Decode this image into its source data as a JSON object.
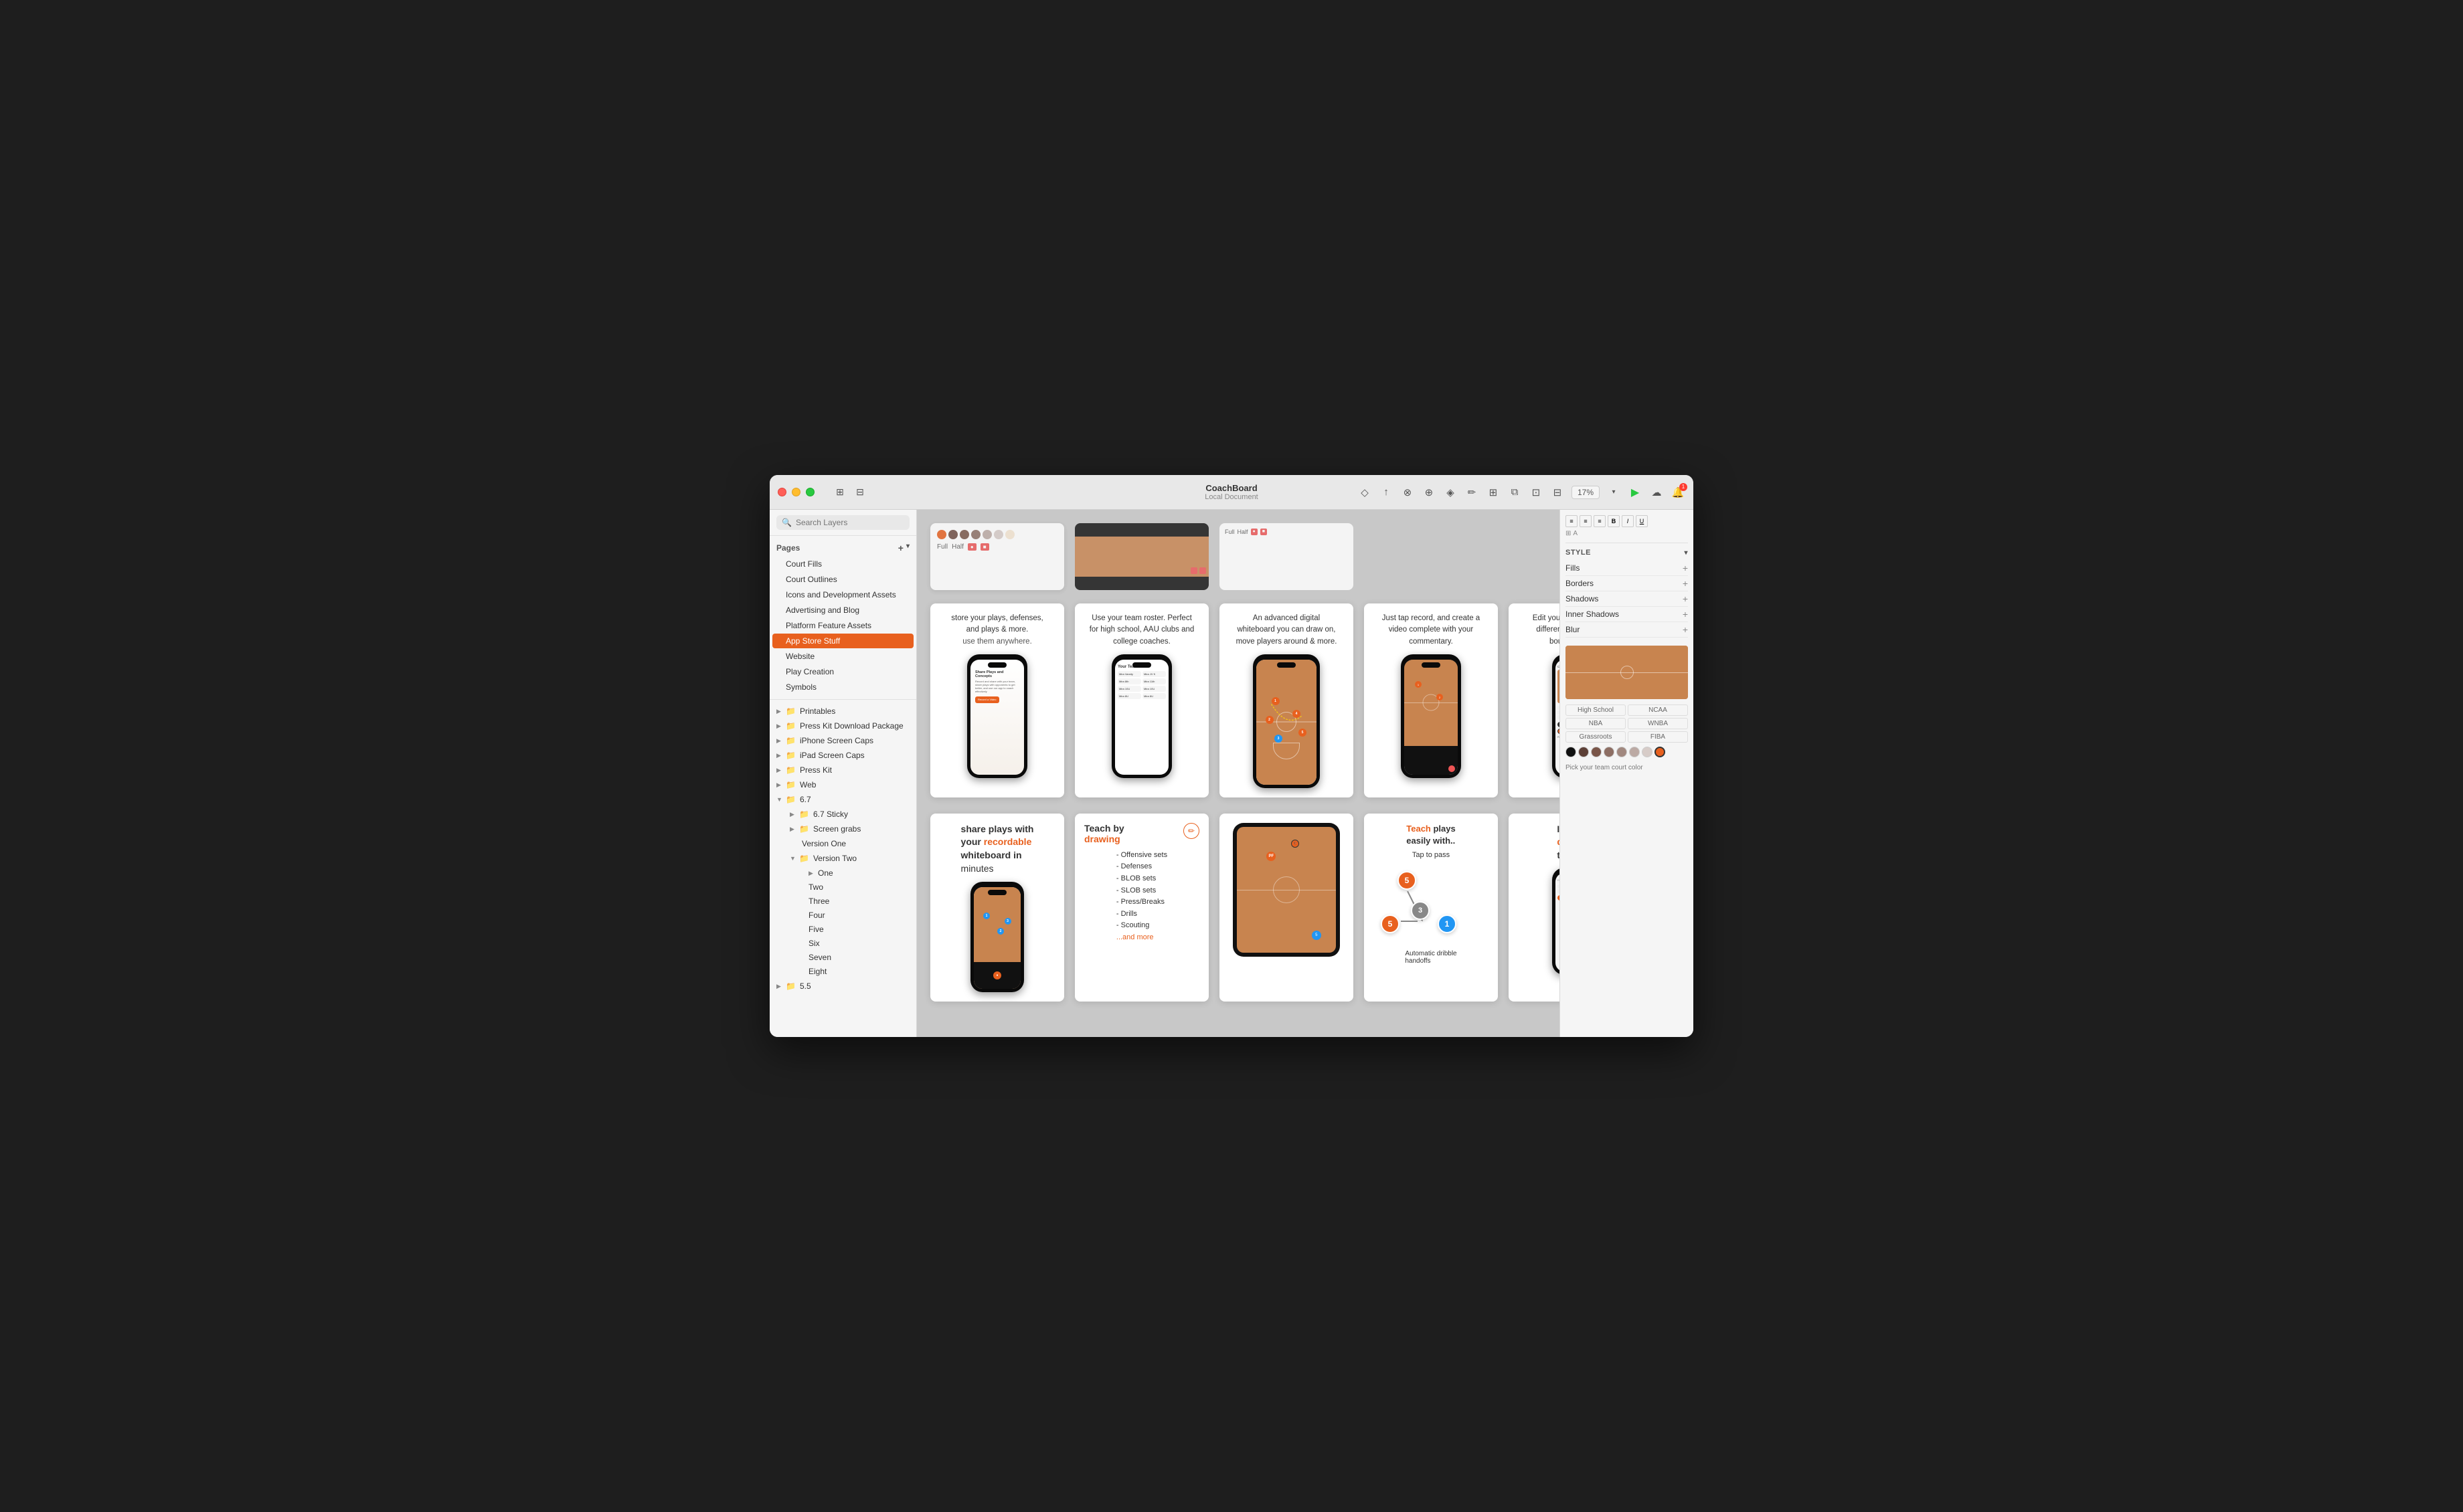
{
  "window": {
    "title": "CoachBoard",
    "subtitle": "Local Document"
  },
  "trafficLights": {
    "red": "close",
    "yellow": "minimize",
    "green": "maximize"
  },
  "toolbar": {
    "addButton": "+",
    "zoomLevel": "17%"
  },
  "sidebar": {
    "searchPlaceholder": "Search Layers",
    "sections": {
      "pages": {
        "label": "Pages",
        "items": [
          {
            "id": "court-fills",
            "label": "Court Fills",
            "active": false
          },
          {
            "id": "court-outlines",
            "label": "Court Outlines",
            "active": false
          },
          {
            "id": "icons-dev",
            "label": "Icons and Development Assets",
            "active": false
          },
          {
            "id": "advertising",
            "label": "Advertising and Blog",
            "active": false
          },
          {
            "id": "platform",
            "label": "Platform Feature Assets",
            "active": false
          },
          {
            "id": "app-store",
            "label": "App Store Stuff",
            "active": true
          },
          {
            "id": "website",
            "label": "Website",
            "active": false
          },
          {
            "id": "play-creation",
            "label": "Play Creation",
            "active": false
          },
          {
            "id": "symbols",
            "label": "Symbols",
            "active": false
          }
        ]
      }
    },
    "layers": {
      "items": [
        {
          "id": "printables",
          "label": "Printables",
          "expanded": false,
          "type": "group"
        },
        {
          "id": "press-kit",
          "label": "Press Kit Download Package",
          "expanded": false,
          "type": "group"
        },
        {
          "id": "iphone-caps",
          "label": "iPhone Screen Caps",
          "expanded": false,
          "type": "group"
        },
        {
          "id": "ipad-caps",
          "label": "iPad Screen Caps",
          "expanded": false,
          "type": "group"
        },
        {
          "id": "press-kit2",
          "label": "Press Kit",
          "expanded": false,
          "type": "group"
        },
        {
          "id": "web",
          "label": "Web",
          "expanded": false,
          "type": "group"
        },
        {
          "id": "v67",
          "label": "6.7",
          "expanded": true,
          "type": "group",
          "children": [
            {
              "id": "67sticky",
              "label": "6.7 Sticky",
              "type": "group",
              "expanded": false
            },
            {
              "id": "screengrabs",
              "label": "Screen grabs",
              "type": "group",
              "expanded": false
            },
            {
              "id": "versionone",
              "label": "Version One",
              "type": "item"
            },
            {
              "id": "versiontwo",
              "label": "Version Two",
              "type": "group",
              "expanded": true,
              "children": [
                {
                  "id": "one",
                  "label": "One",
                  "type": "item"
                },
                {
                  "id": "two",
                  "label": "Two",
                  "type": "item"
                },
                {
                  "id": "three",
                  "label": "Three",
                  "type": "item"
                },
                {
                  "id": "four",
                  "label": "Four",
                  "type": "item"
                },
                {
                  "id": "five",
                  "label": "Five",
                  "type": "item"
                },
                {
                  "id": "six",
                  "label": "Six",
                  "type": "item"
                },
                {
                  "id": "seven",
                  "label": "Seven",
                  "type": "item"
                },
                {
                  "id": "eight",
                  "label": "Eight",
                  "type": "item"
                }
              ]
            }
          ]
        },
        {
          "id": "v55",
          "label": "5.5",
          "expanded": false,
          "type": "group"
        }
      ]
    }
  },
  "rightPanel": {
    "style": {
      "label": "STYLE",
      "fills": "Fills",
      "borders": "Borders",
      "shadows": "Shadows",
      "innerShadows": "Inner Shadows",
      "blur": "Blur"
    },
    "colorSwatches": [
      "#e8601e",
      "#888888",
      "#5d4037",
      "#795548",
      "#a1887f",
      "#bcaaa4",
      "#d7ccc8",
      "#f5e6d3"
    ],
    "courtColors": {
      "highSchool": "High School",
      "ncaa": "NCAA",
      "nba": "NBA",
      "wnba": "WNBA",
      "grassroots": "Grassroots",
      "fiba": "FIBA"
    },
    "thumbnail": {
      "alt": "Court color thumbnail"
    }
  },
  "canvas": {
    "topRow": [
      {
        "id": "feature1",
        "titleLines": [
          "store your plays, defenses,",
          "and plays & more.",
          "use them anywhere."
        ],
        "type": "text-phone"
      },
      {
        "id": "feature2",
        "titleLines": [
          "Use your team roster. Perfect",
          "for high school, AAU clubs and",
          "college coaches."
        ],
        "type": "roster-phone"
      },
      {
        "id": "feature3",
        "titleLines": [
          "An advanced digital",
          "whiteboard you can draw on,",
          "move players around & more."
        ],
        "type": "court-phone"
      },
      {
        "id": "feature4",
        "titleLines": [
          "Just tap record, and create a",
          "video complete with your",
          "commentary."
        ],
        "type": "dark-court-phone"
      },
      {
        "id": "feature5",
        "titleLines": [
          "Edit your whiteboard with",
          "different hardwood and",
          "boundary lines."
        ],
        "type": "court-panel-phone"
      }
    ],
    "bottomRow": [
      {
        "id": "bottom1",
        "titleLines": [
          "share plays with",
          "your recordable",
          "whiteboard in",
          "minutes"
        ],
        "highlight": "recordable",
        "type": "text-phone-bottom"
      },
      {
        "id": "bottom2",
        "titleLines": [
          "Teach by",
          "drawing"
        ],
        "highlight": "drawing",
        "bullets": [
          "Offensive sets",
          "Defenses",
          "BLOB sets",
          "SLOB sets",
          "Press/Breaks",
          "Drills",
          "Scouting",
          "...and more"
        ],
        "type": "teach-list"
      },
      {
        "id": "bottom3",
        "type": "tablet-court",
        "titleLines": []
      },
      {
        "id": "bottom4",
        "titleLines": [
          "Teach plays",
          "easily with.."
        ],
        "highlight": "Teach",
        "subTitle": "Tap to pass",
        "subDesc": "Automatic dribble handoffs",
        "type": "teach-diagram"
      },
      {
        "id": "bottom5",
        "titleLines": [
          "Industry",
          "diagra",
          "to.."
        ],
        "highlight": "Industry",
        "type": "industry-phone"
      }
    ]
  }
}
